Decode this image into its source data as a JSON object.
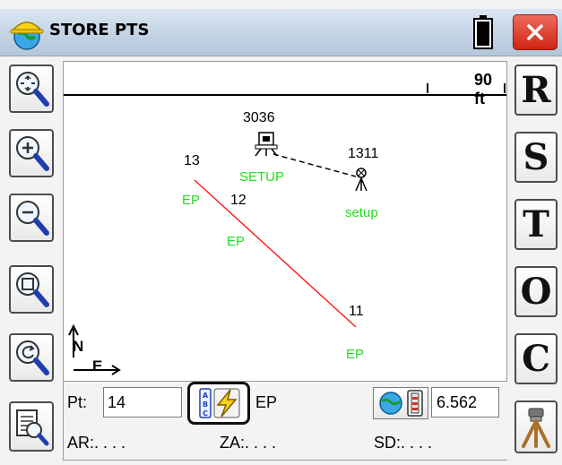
{
  "window": {
    "title": "STORE PTS",
    "app_icon": "hardhat-globe-icon",
    "battery_icon": "battery-icon",
    "close_icon": "close-icon",
    "close_color": "#d9301f"
  },
  "left_toolbar": [
    {
      "name": "zoom-extents-button",
      "icon": "zoom-extents-icon"
    },
    {
      "name": "zoom-in-button",
      "icon": "zoom-in-icon"
    },
    {
      "name": "zoom-out-button",
      "icon": "zoom-out-icon"
    },
    {
      "name": "zoom-window-button",
      "icon": "zoom-window-icon"
    },
    {
      "name": "zoom-previous-button",
      "icon": "zoom-previous-icon"
    },
    {
      "name": "point-list-button",
      "icon": "point-list-icon"
    }
  ],
  "right_toolbar": {
    "r": "R",
    "s": "S",
    "t": "T",
    "o": "O",
    "c": "C",
    "instrument_icon": "tripod-icon"
  },
  "map": {
    "scale_label": "90 ft",
    "north_label": "N",
    "east_label": "E",
    "line_color": "#ff2020",
    "code_color": "#1fdd1f",
    "points": [
      {
        "number": "3036",
        "code": "SETUP",
        "icon": "total-station-icon"
      },
      {
        "number": "1311",
        "code": "setup",
        "icon": "tripod-target-icon"
      },
      {
        "number": "13",
        "code": "EP"
      },
      {
        "number": "12",
        "code": "EP"
      },
      {
        "number": "11",
        "code": "EP"
      }
    ]
  },
  "bottom": {
    "pt_label": "Pt:",
    "pt_value": "14",
    "code_button_icon": "abc-lightning-icon",
    "code_value": "EP",
    "instrument_button_icon": "globe-level-icon",
    "hi_value": "6.562",
    "ar_label": "AR:. . . .",
    "za_label": "ZA:. . . .",
    "sd_label": "SD:. . . ."
  }
}
